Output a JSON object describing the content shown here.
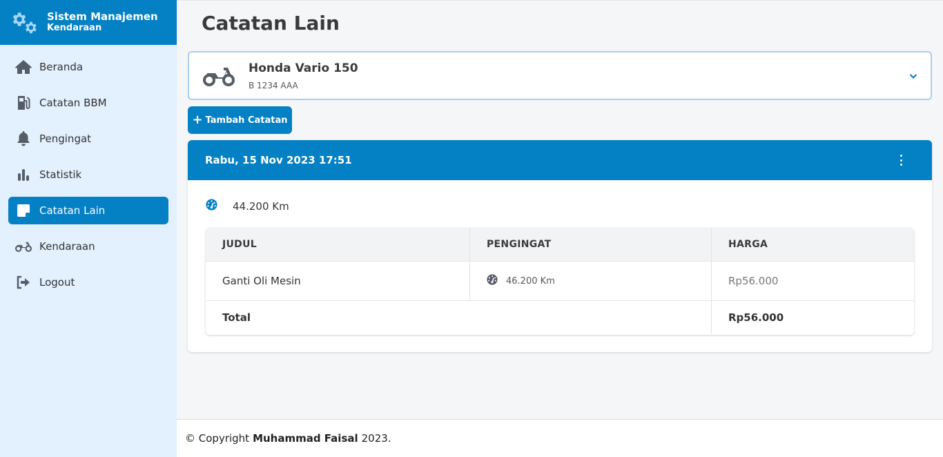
{
  "brand": {
    "title": "Sistem Manajemen",
    "subtitle": "Kendaraan"
  },
  "sidebar": {
    "items": [
      {
        "label": "Beranda",
        "icon": "home-icon"
      },
      {
        "label": "Catatan BBM",
        "icon": "gas-pump-icon"
      },
      {
        "label": "Pengingat",
        "icon": "bell-icon"
      },
      {
        "label": "Statistik",
        "icon": "bar-chart-icon"
      },
      {
        "label": "Catatan Lain",
        "icon": "note-icon",
        "active": true
      },
      {
        "label": "Kendaraan",
        "icon": "motorcycle-icon"
      },
      {
        "label": "Logout",
        "icon": "logout-icon"
      }
    ]
  },
  "page": {
    "title": "Catatan Lain"
  },
  "vehicle": {
    "name": "Honda Vario 150",
    "plate": "B 1234 AAA"
  },
  "add_button": {
    "label": "Tambah Catatan"
  },
  "record": {
    "date": "Rabu, 15 Nov 2023 17:51",
    "odometer": "44.200 Km",
    "table": {
      "headers": [
        "JUDUL",
        "PENGINGAT",
        "HARGA"
      ],
      "rows": [
        {
          "judul": "Ganti Oli Mesin",
          "pengingat": "46.200 Km",
          "harga": "Rp56.000"
        }
      ],
      "total_label": "Total",
      "total_value": "Rp56.000"
    }
  },
  "footer": {
    "prefix": "© Copyright",
    "author": "Muhammad Faisal",
    "year": "2023."
  },
  "colors": {
    "primary": "#0480c4",
    "sidebar_bg": "#e3f0fd",
    "icon_gray": "#555c66"
  }
}
